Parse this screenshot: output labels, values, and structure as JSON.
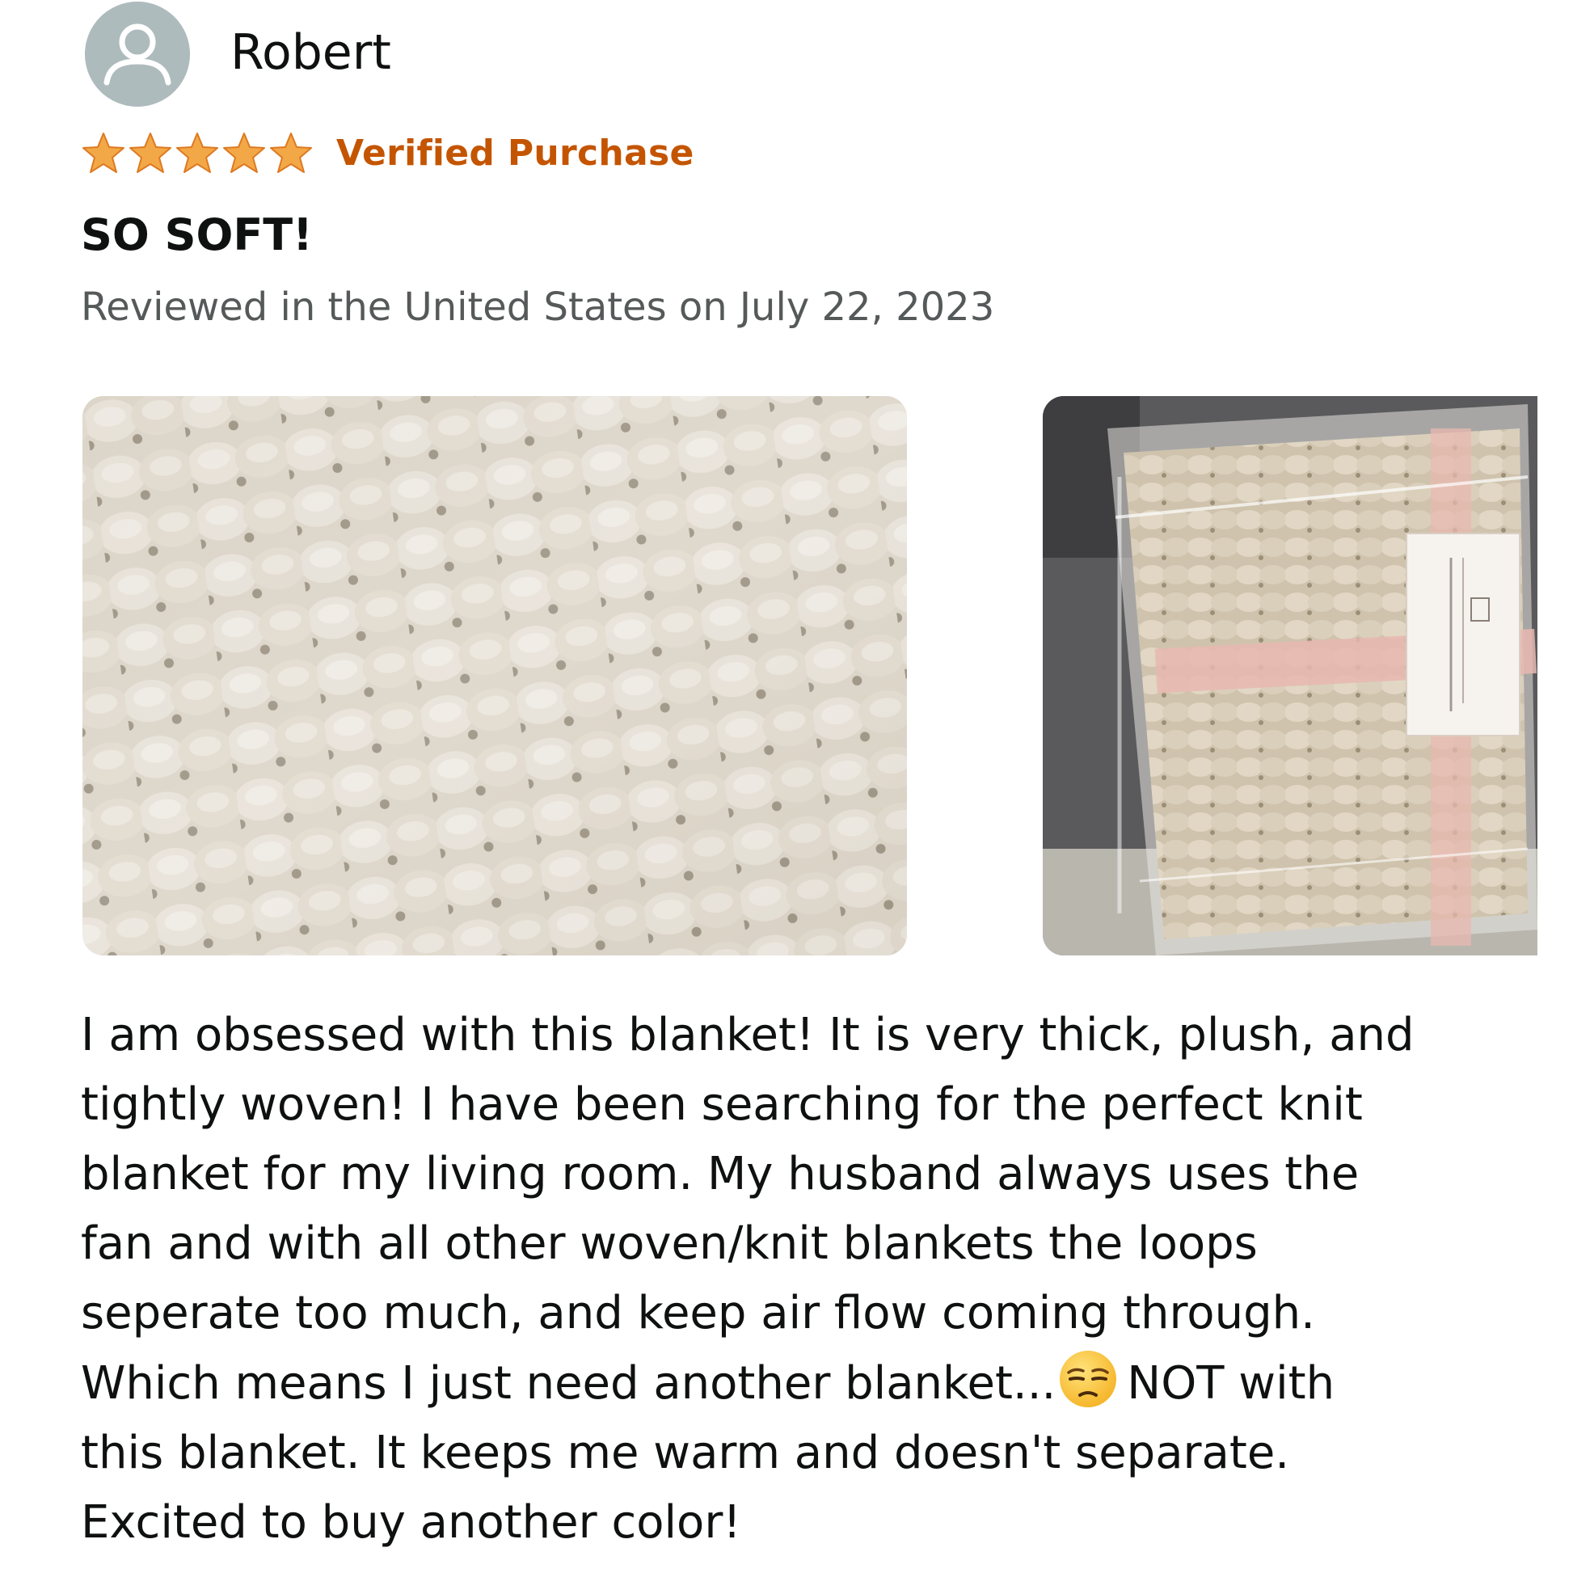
{
  "review": {
    "reviewer_name": "Robert",
    "avatar_icon": "user-silhouette-icon",
    "rating": {
      "value": 5,
      "max": 5,
      "star_color": "#f3a847"
    },
    "verified_label": "Verified Purchase",
    "verified_color": "#c45500",
    "title": "SO SOFT!",
    "meta": "Reviewed in the United States on July 22, 2023",
    "photos": [
      {
        "name": "review-photo-knit-closeup"
      },
      {
        "name": "review-photo-packaged-blanket"
      }
    ],
    "body_lines": [
      "I am obsessed with this blanket! It is very thick, plush, and",
      "tightly woven! I have been searching for the perfect knit",
      "blanket for my living room. My husband always uses the",
      "fan and with all other woven/knit blankets the loops",
      "seperate too much, and keep air flow coming through.",
      "Which means I just need another blanket...",
      "NOT with",
      "this blanket. It keeps me warm and doesn't separate.",
      "Excited to buy another color!"
    ],
    "emoji_icon": "unamused-face-emoji"
  }
}
